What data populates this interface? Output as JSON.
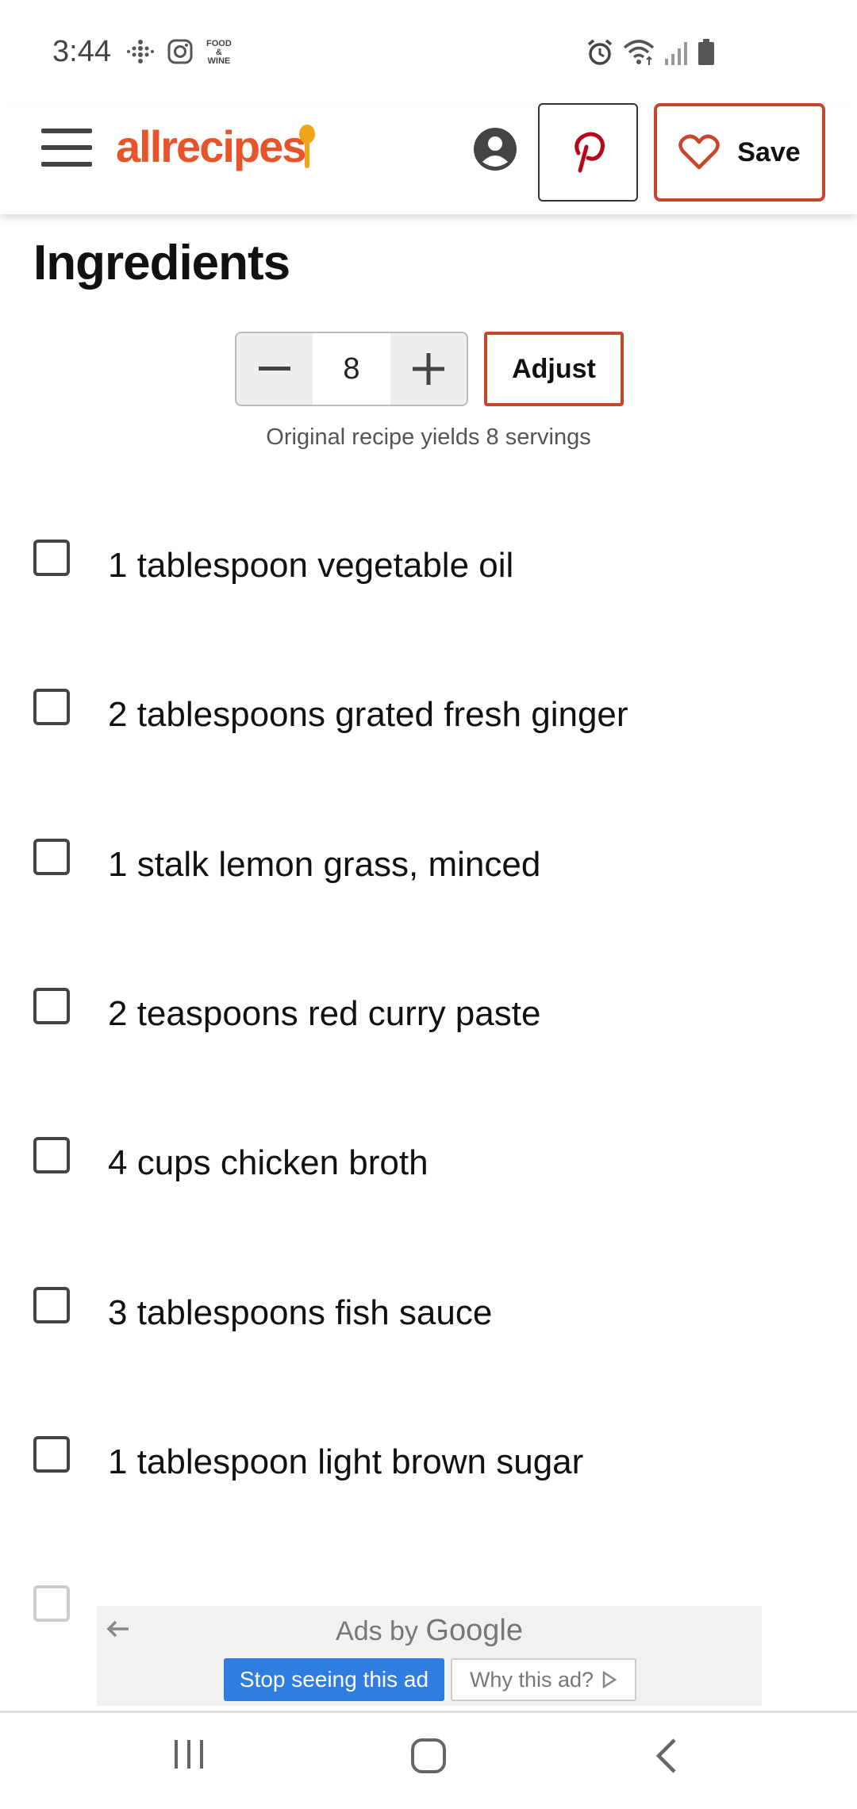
{
  "status_bar": {
    "time": "3:44",
    "food_wine_label": [
      "FOOD",
      "&",
      "WINE"
    ],
    "icons": [
      "fitbit-icon",
      "instagram-icon",
      "food-wine-icon",
      "alarm-icon",
      "wifi-icon",
      "signal-icon",
      "battery-icon"
    ]
  },
  "header": {
    "logo_text": "allrecipes",
    "menu_icon": "hamburger-icon",
    "profile_icon": "account-icon",
    "pinterest_icon": "pinterest-icon",
    "save_label": "Save",
    "accent_color": "#c8442a",
    "logo_color": "#e8542a"
  },
  "ingredients_section": {
    "heading": "Ingredients",
    "servings_value": "8",
    "adjust_label": "Adjust",
    "yield_note": "Original recipe yields 8 servings",
    "items": [
      "1 tablespoon vegetable oil",
      "2 tablespoons grated fresh ginger",
      "1 stalk lemon grass, minced",
      "2 teaspoons red curry paste",
      "4 cups chicken broth",
      "3 tablespoons fish sauce",
      "1 tablespoon light brown sugar"
    ]
  },
  "ad": {
    "ads_by": "Ads by",
    "google": "Google",
    "stop_label": "Stop seeing this ad",
    "why_label": "Why this ad?",
    "stop_color": "#2f7de1"
  },
  "nav_bar": {
    "icons": [
      "recent-apps-icon",
      "home-icon",
      "back-icon"
    ]
  }
}
